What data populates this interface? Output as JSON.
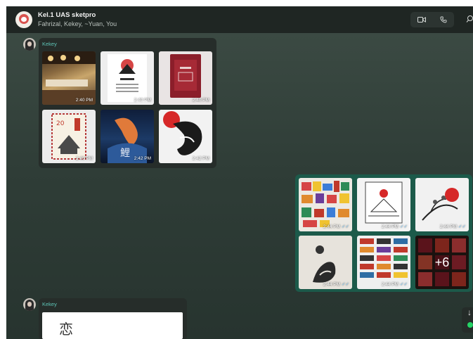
{
  "header": {
    "group_name": "Kel.1 UAS sketpro",
    "members": "Fahrizal, Kekey, ~Yuan, You"
  },
  "messages": [
    {
      "sender": "Kekey",
      "images": [
        {
          "time": "2:40 PM",
          "desc": "restaurant"
        },
        {
          "time": "2:40 PM",
          "desc": "ikigai poster"
        },
        {
          "time": "2:40 PM",
          "desc": "red card"
        },
        {
          "time": "2:40 PM",
          "desc": "stamp"
        },
        {
          "time": "2:42 PM",
          "desc": "koi"
        },
        {
          "time": "2:42 PM",
          "desc": "dragon"
        }
      ]
    },
    {
      "sent_images": [
        {
          "time": "2:44 PM"
        },
        {
          "time": "2:44 PM"
        },
        {
          "time": "2:44 PM"
        },
        {
          "time": "2:44 PM"
        },
        {
          "time": "2:44 PM"
        },
        {
          "more": "+6"
        }
      ]
    },
    {
      "sender": "Kekey",
      "doc_glyph": "恋"
    }
  ],
  "icons": [
    "video-call-icon",
    "voice-call-icon",
    "search-icon",
    "scroll-down-icon"
  ],
  "colors": {
    "sender_name": "#5ec4b6",
    "sent_bubble": "#1c5a4a",
    "header": "#1f2623"
  }
}
